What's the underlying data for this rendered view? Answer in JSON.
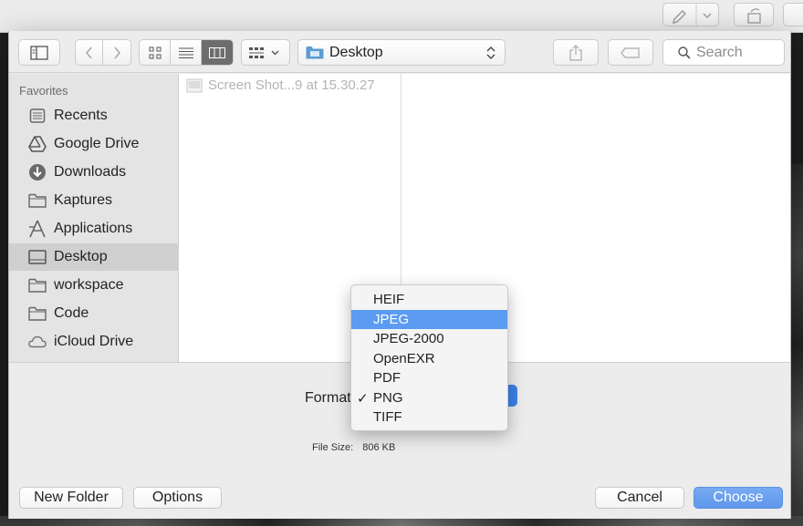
{
  "toolbar": {
    "location": "Desktop",
    "search_placeholder": "Search"
  },
  "sidebar": {
    "heading": "Favorites",
    "items": [
      {
        "label": "Recents",
        "icon": "recents-icon"
      },
      {
        "label": "Google Drive",
        "icon": "google-drive-icon"
      },
      {
        "label": "Downloads",
        "icon": "downloads-icon"
      },
      {
        "label": "Kaptures",
        "icon": "folder-icon"
      },
      {
        "label": "Applications",
        "icon": "applications-icon"
      },
      {
        "label": "Desktop",
        "icon": "desktop-icon",
        "selected": true
      },
      {
        "label": "workspace",
        "icon": "folder-icon"
      },
      {
        "label": "Code",
        "icon": "folder-icon"
      },
      {
        "label": "iCloud Drive",
        "icon": "icloud-icon"
      }
    ]
  },
  "browser": {
    "files": [
      {
        "name": "Screen Shot...9 at 15.30.27",
        "dimmed": true
      }
    ]
  },
  "accessory": {
    "format_label": "Format",
    "file_size_label": "File Size:",
    "file_size_value": "806 KB"
  },
  "format_menu": {
    "options": [
      "HEIF",
      "JPEG",
      "JPEG-2000",
      "OpenEXR",
      "PDF",
      "PNG",
      "TIFF"
    ],
    "highlighted": "JPEG",
    "checked": "PNG",
    "check_mark": "✓"
  },
  "buttons": {
    "new_folder": "New Folder",
    "options": "Options",
    "cancel": "Cancel",
    "choose": "Choose"
  },
  "colors": {
    "accent": "#5b9bf1",
    "primary_button": "#6a9fee",
    "selection": "#cfcfcf"
  }
}
